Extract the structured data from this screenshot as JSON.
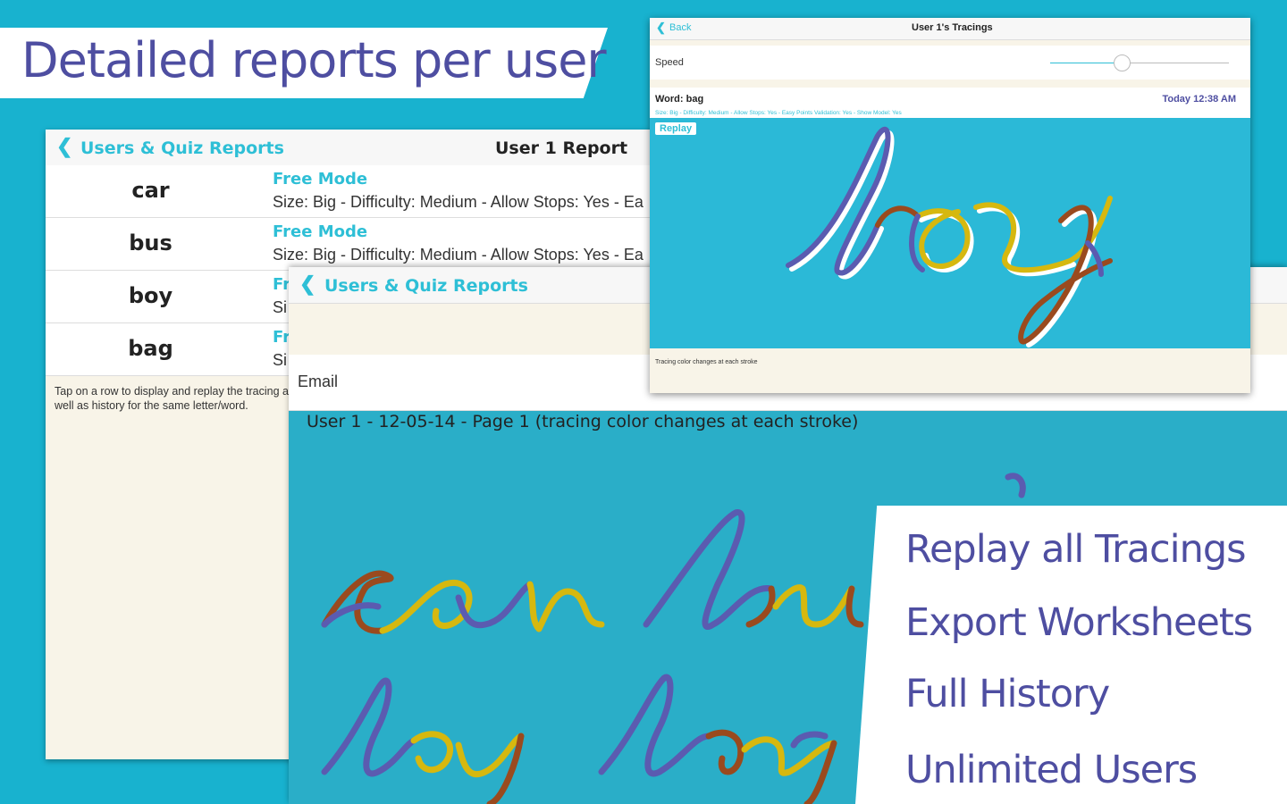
{
  "banner": {
    "title": "Detailed reports per user"
  },
  "report": {
    "back_label": "Users & Quiz Reports",
    "title": "User 1 Report",
    "rows": [
      {
        "word": "car",
        "mode": "Free Mode",
        "detail": "Size: Big - Difficulty: Medium - Allow Stops: Yes - Ea"
      },
      {
        "word": "bus",
        "mode": "Free Mode",
        "detail": "Size: Big - Difficulty: Medium - Allow Stops: Yes - Ea"
      },
      {
        "word": "boy",
        "mode": "Fr",
        "detail": "Si"
      },
      {
        "word": "bag",
        "mode": "Fr",
        "detail": "Si"
      }
    ],
    "help": "Tap on a row to display and replay the tracing as well as history for the same letter/word."
  },
  "export": {
    "back_label": "Users & Quiz Reports",
    "email_label": "Email",
    "caption": "User 1 - 12-05-14 - Page 1 (tracing color changes at each stroke)"
  },
  "tracings": {
    "back_label": "Back",
    "title": "User 1's Tracings",
    "speed_label": "Speed",
    "speed_value": 0.4,
    "word_label": "Word: bag",
    "timestamp": "Today 12:38 AM",
    "detail": "Size: Big - Difficulty: Medium - Allow Stops: Yes - Easy Points Validation: Yes - Show Model: Yes",
    "replay_label": "Replay",
    "footer": "Tracing color changes at each stroke"
  },
  "features": [
    "Replay all Tracings",
    "Export Worksheets",
    "Full History",
    "Unlimited Users"
  ],
  "colors": {
    "background": "#18b2cf",
    "accent": "#2ebfd6",
    "headline": "#4e4ea1",
    "stroke_purple": "#5b5bb0",
    "stroke_brown": "#9a4a1e",
    "stroke_yellow": "#d6b80f"
  }
}
